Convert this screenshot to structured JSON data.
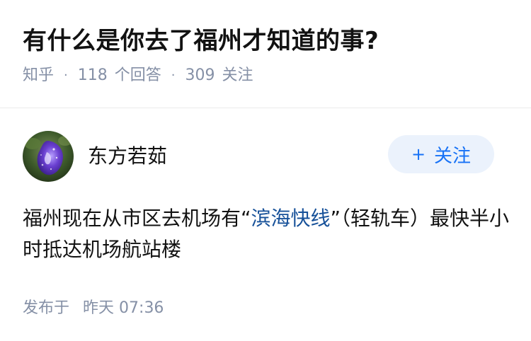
{
  "question": {
    "title": "有什么是你去了福州才知道的事?",
    "source": "知乎",
    "answers_count": "118",
    "answers_label": "个回答",
    "followers_count": "309",
    "followers_label": "关注",
    "separator": "·"
  },
  "answer": {
    "author_name": "东方若茹",
    "follow_label": "关注",
    "follow_icon": "plus-icon",
    "content_before": "福州现在从市区去机场有“",
    "content_link": "滨海快线",
    "content_after": "”（轻轨车）最快半小时抵达机场航站楼",
    "published_label": "发布于",
    "published_day": "昨天",
    "published_time": "07:36"
  },
  "colors": {
    "accent": "#1772f6",
    "link": "#175199",
    "meta": "#8590a6",
    "follow_bg": "#ebf2fc"
  }
}
